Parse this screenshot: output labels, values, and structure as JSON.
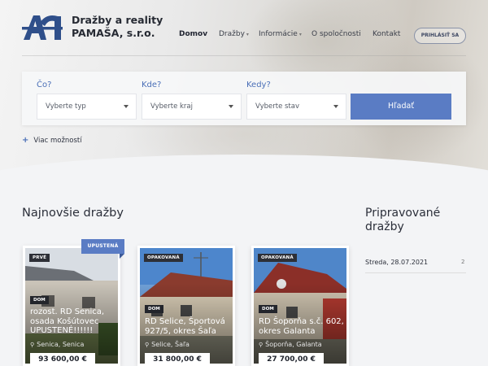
{
  "brand": {
    "line1": "Dražby a reality",
    "line2": "PAMAŠA, s.r.o.",
    "logo_icon": "letter-a-monogram-icon"
  },
  "nav": {
    "items": [
      {
        "label": "Domov",
        "active": true,
        "has_dropdown": false
      },
      {
        "label": "Dražby",
        "active": false,
        "has_dropdown": true
      },
      {
        "label": "Informácie",
        "active": false,
        "has_dropdown": true
      },
      {
        "label": "O spoločnosti",
        "active": false,
        "has_dropdown": false
      },
      {
        "label": "Kontakt",
        "active": false,
        "has_dropdown": false
      }
    ],
    "login_label": "PRIHLÁSIŤ SA"
  },
  "search": {
    "fields": [
      {
        "label": "Čo?",
        "placeholder": "Vyberte typ"
      },
      {
        "label": "Kde?",
        "placeholder": "Vyberte kraj"
      },
      {
        "label": "Kedy?",
        "placeholder": "Vyberte stav"
      }
    ],
    "button_label": "Hľadať",
    "more_label": "Viac možností"
  },
  "latest": {
    "heading": "Najnovšie dražby",
    "cards": [
      {
        "tag": "PRVÉ",
        "ribbon": "UPUSTENÁ",
        "type": "DOM",
        "title": "rozost. RD Senica, osada Košútovec UPUSTENÉ!!!!!!",
        "location": "Senica, Senica",
        "price": "93 600,00 €"
      },
      {
        "tag": "OPAKOVANÁ",
        "type": "DOM",
        "title": "RD Selice, Športová 927/5, okres Šaľa",
        "location": "Selice, Šaľa",
        "price": "31 800,00 €"
      },
      {
        "tag": "OPAKOVANÁ",
        "type": "DOM",
        "title": "RD Šoporňa s.č. 602, okres Galanta",
        "location": "Šoporňa, Galanta",
        "price": "27 700,00 €"
      }
    ]
  },
  "upcoming": {
    "heading": "Pripravované dražby",
    "items": [
      {
        "date": "Streda, 28.07.2021",
        "count": "2"
      }
    ]
  },
  "colors": {
    "accent": "#5a7cc4",
    "label_blue": "#4a6fb7",
    "text_dark": "#2b2f3a"
  }
}
